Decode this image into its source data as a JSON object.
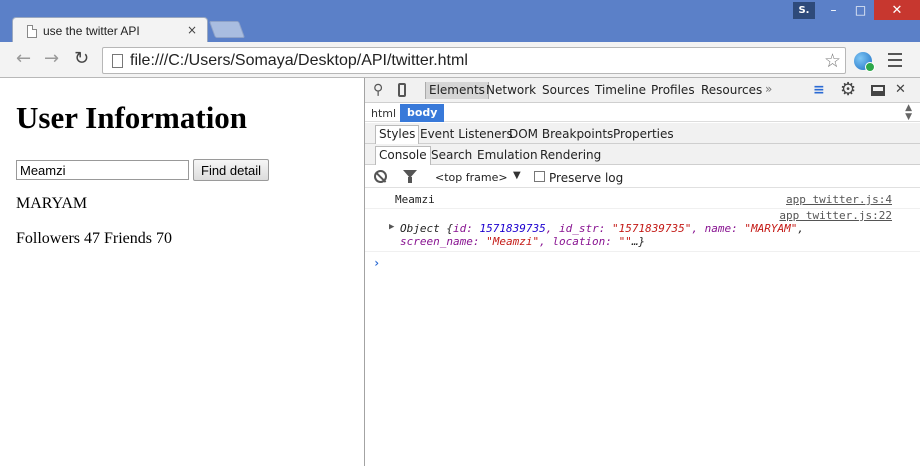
{
  "window": {
    "tab_title": "use the twitter API",
    "tab_close": "×",
    "user_initial": "S.",
    "minimize": "–",
    "maximize": "□",
    "close": "✕"
  },
  "toolbar": {
    "back": "←",
    "forward": "→",
    "reload": "↻",
    "url": "file:///C:/Users/Somaya/Desktop/API/twitter.html",
    "star": "☆"
  },
  "page": {
    "title": "User Information",
    "input_value": "Meamzi",
    "button_label": "Find detail",
    "result_name": "MARYAM",
    "result_stats": "Followers 47 Friends 70"
  },
  "devtools": {
    "tabs": [
      "Elements",
      "Network",
      "Sources",
      "Timeline",
      "Profiles",
      "Resources"
    ],
    "more": "»",
    "breadcrumbs": [
      "html",
      "body"
    ],
    "sub_tabs": [
      "Styles",
      "Event Listeners",
      "DOM Breakpoints",
      "Properties"
    ],
    "drawer_tabs": [
      "Console",
      "Search",
      "Emulation",
      "Rendering"
    ],
    "console_toolbar": {
      "frame": "<top frame>",
      "frame_arrow": "▼",
      "preserve_label": "Preserve log"
    },
    "messages": [
      {
        "text": "Meamzi",
        "source": "app twitter.js:4"
      },
      {
        "source": "app twitter.js:22",
        "object": {
          "prefix": "Object {",
          "id_key": "id: ",
          "id_val": "1571839735",
          "idstr_key": ", id_str: ",
          "idstr_val": "\"1571839735\"",
          "name_key": ", name: ",
          "name_val": "\"MARYAM\"",
          "line1_end": ",",
          "screen_key": "screen_name: ",
          "screen_val": "\"Meamzi\"",
          "loc_key": ", location: ",
          "loc_val": "\"\"",
          "suffix": "…}"
        }
      }
    ],
    "prompt": "›"
  },
  "colors": {
    "chrome_frame": "#5b80c8",
    "selected_breadcrumb": "#3879d9",
    "console_key": "#881391",
    "console_number": "#1c00cf",
    "console_string": "#c41a16"
  }
}
